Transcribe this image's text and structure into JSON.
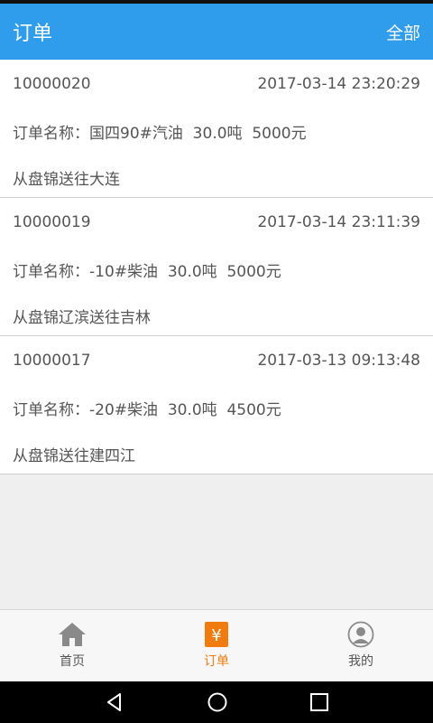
{
  "header": {
    "title": "订单",
    "action": "全部"
  },
  "orders": [
    {
      "id": "10000020",
      "time": "2017-03-14 23:20:29",
      "name": "订单名称：国四90#汽油  30.0吨  5000元",
      "route": "从盘锦送往大连"
    },
    {
      "id": "10000019",
      "time": "2017-03-14 23:11:39",
      "name": "订单名称：-10#柴油  30.0吨  5000元",
      "route": "从盘锦辽滨送往吉林"
    },
    {
      "id": "10000017",
      "time": "2017-03-13 09:13:48",
      "name": "订单名称：-20#柴油  30.0吨  4500元",
      "route": "从盘锦送往建四江"
    }
  ],
  "tabs": [
    {
      "label": "首页",
      "icon": "home-icon",
      "active": false
    },
    {
      "label": "订单",
      "icon": "yen-order-icon",
      "active": true
    },
    {
      "label": "我的",
      "icon": "profile-icon",
      "active": false
    }
  ],
  "navbar": {
    "icons": [
      "back-icon",
      "home-circle-icon",
      "recents-icon"
    ]
  },
  "colors": {
    "primary": "#2f9cec",
    "accent": "#f07c10",
    "background": "#efefef"
  }
}
